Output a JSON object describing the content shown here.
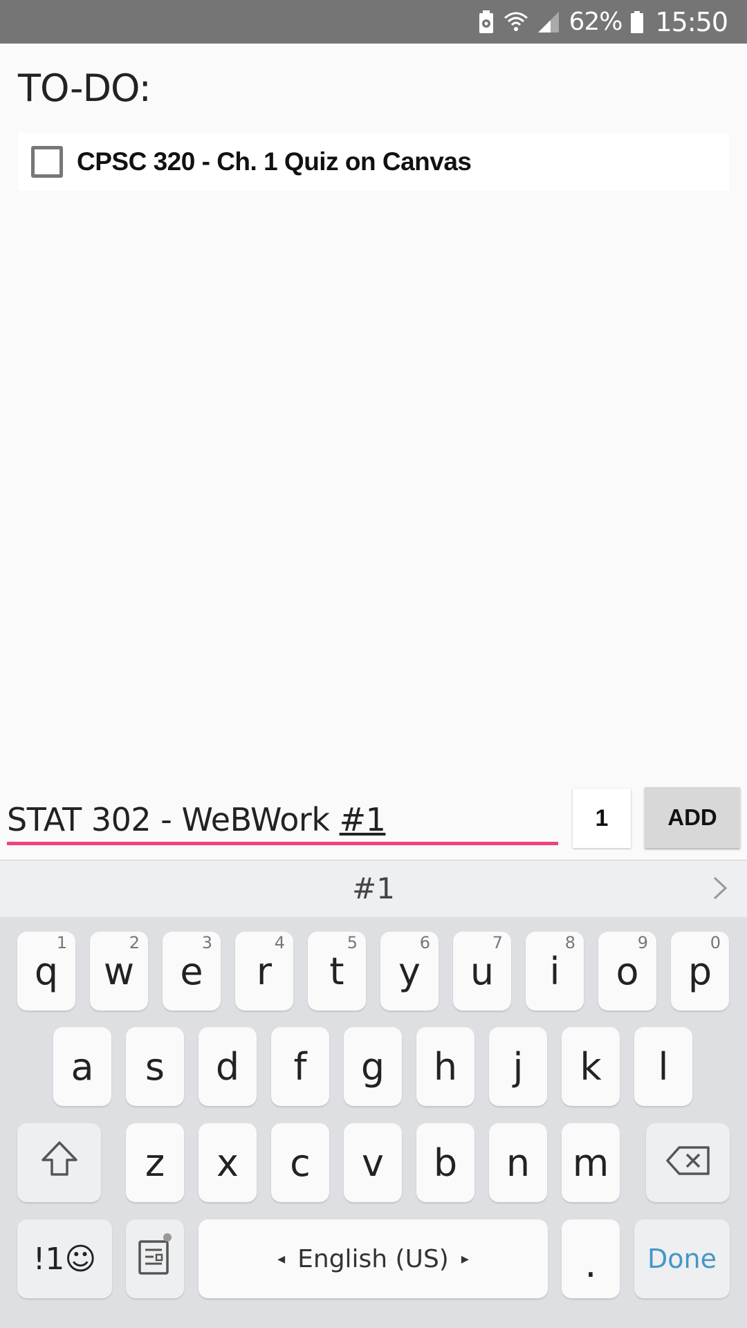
{
  "status_bar": {
    "battery_percent": "62%",
    "time": "15:50",
    "icons": [
      "battery-saver-icon",
      "wifi-icon",
      "signal-icon",
      "battery-icon"
    ]
  },
  "app": {
    "title": "TO-DO:",
    "items": [
      {
        "label": "CPSC 320 - Ch. 1 Quiz on Canvas",
        "checked": false
      }
    ]
  },
  "input": {
    "text_prefix": "STAT 302 - WeBWork ",
    "text_composing": "#1",
    "quantity": "1",
    "add_label": "ADD",
    "underline_color": "#f0437a"
  },
  "keyboard": {
    "suggestion": "#1",
    "row1": [
      {
        "k": "q",
        "h": "1"
      },
      {
        "k": "w",
        "h": "2"
      },
      {
        "k": "e",
        "h": "3"
      },
      {
        "k": "r",
        "h": "4"
      },
      {
        "k": "t",
        "h": "5"
      },
      {
        "k": "y",
        "h": "6"
      },
      {
        "k": "u",
        "h": "7"
      },
      {
        "k": "i",
        "h": "8"
      },
      {
        "k": "o",
        "h": "9"
      },
      {
        "k": "p",
        "h": "0"
      }
    ],
    "row2": [
      "a",
      "s",
      "d",
      "f",
      "g",
      "h",
      "j",
      "k",
      "l"
    ],
    "row3": [
      "z",
      "x",
      "c",
      "v",
      "b",
      "n",
      "m"
    ],
    "symbols_label": "!1☺",
    "space_label": "English (US)",
    "period_label": ".",
    "done_label": "Done",
    "done_color": "#4596c7"
  }
}
